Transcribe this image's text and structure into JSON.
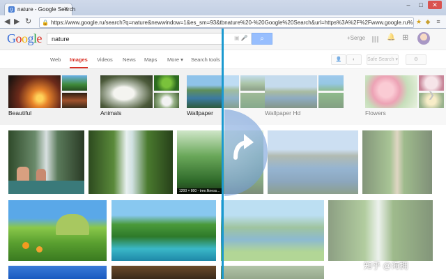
{
  "browser": {
    "tab_title": "nature - Google Search",
    "url": "https://www.google.ru/search?q=nature&newwindow=1&es_sm=93&tbnature%20-%20Google%20Search&url=https%3A%2F%2Fwww.google.ru%2F"
  },
  "google": {
    "logo": [
      "G",
      "o",
      "o",
      "g",
      "l",
      "e"
    ],
    "query": "nature",
    "plus_user": "+Serge"
  },
  "search_nav": {
    "tabs": [
      "Web",
      "Images",
      "Videos",
      "News",
      "Maps",
      "More ▾",
      "Search tools"
    ],
    "active": "Images",
    "safe_search": "Safe Search ▾"
  },
  "related": [
    {
      "label": "Beautiful"
    },
    {
      "label": "Animals"
    },
    {
      "label": "Wallpaper"
    },
    {
      "label": "Wallpaper Hd"
    },
    {
      "label": "Flowers"
    }
  ],
  "results": {
    "hover_caption": "1200 × 800 - tree.fitness..."
  },
  "watermark": "知乎 @海拥"
}
